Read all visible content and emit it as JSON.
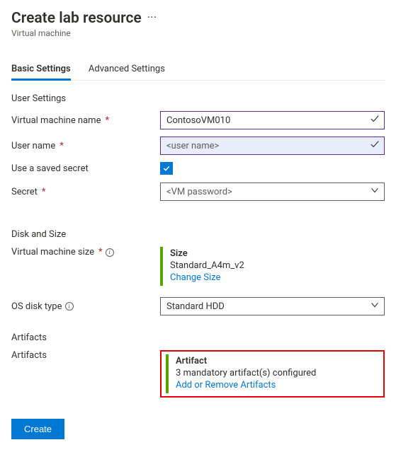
{
  "header": {
    "title": "Create lab resource",
    "subtitle": "Virtual machine"
  },
  "tabs": {
    "basic": "Basic Settings",
    "advanced": "Advanced Settings"
  },
  "sections": {
    "user_settings": "User Settings",
    "disk_and_size": "Disk and Size",
    "artifacts": "Artifacts"
  },
  "fields": {
    "vm_name": {
      "label": "Virtual machine name",
      "value": "ContosoVM010"
    },
    "user_name": {
      "label": "User name",
      "placeholder": "<user name>"
    },
    "use_saved_secret": {
      "label": "Use a saved secret"
    },
    "secret": {
      "label": "Secret",
      "placeholder": "<VM password>"
    },
    "vm_size": {
      "label": "Virtual machine size"
    },
    "os_disk_type": {
      "label": "OS disk type",
      "value": "Standard HDD"
    },
    "artifacts_label": "Artifacts"
  },
  "size_card": {
    "title": "Size",
    "value": "Standard_A4m_v2",
    "link": "Change Size"
  },
  "artifact_card": {
    "title": "Artifact",
    "line": "3 mandatory artifact(s) configured",
    "link": "Add or Remove Artifacts"
  },
  "buttons": {
    "create": "Create"
  }
}
